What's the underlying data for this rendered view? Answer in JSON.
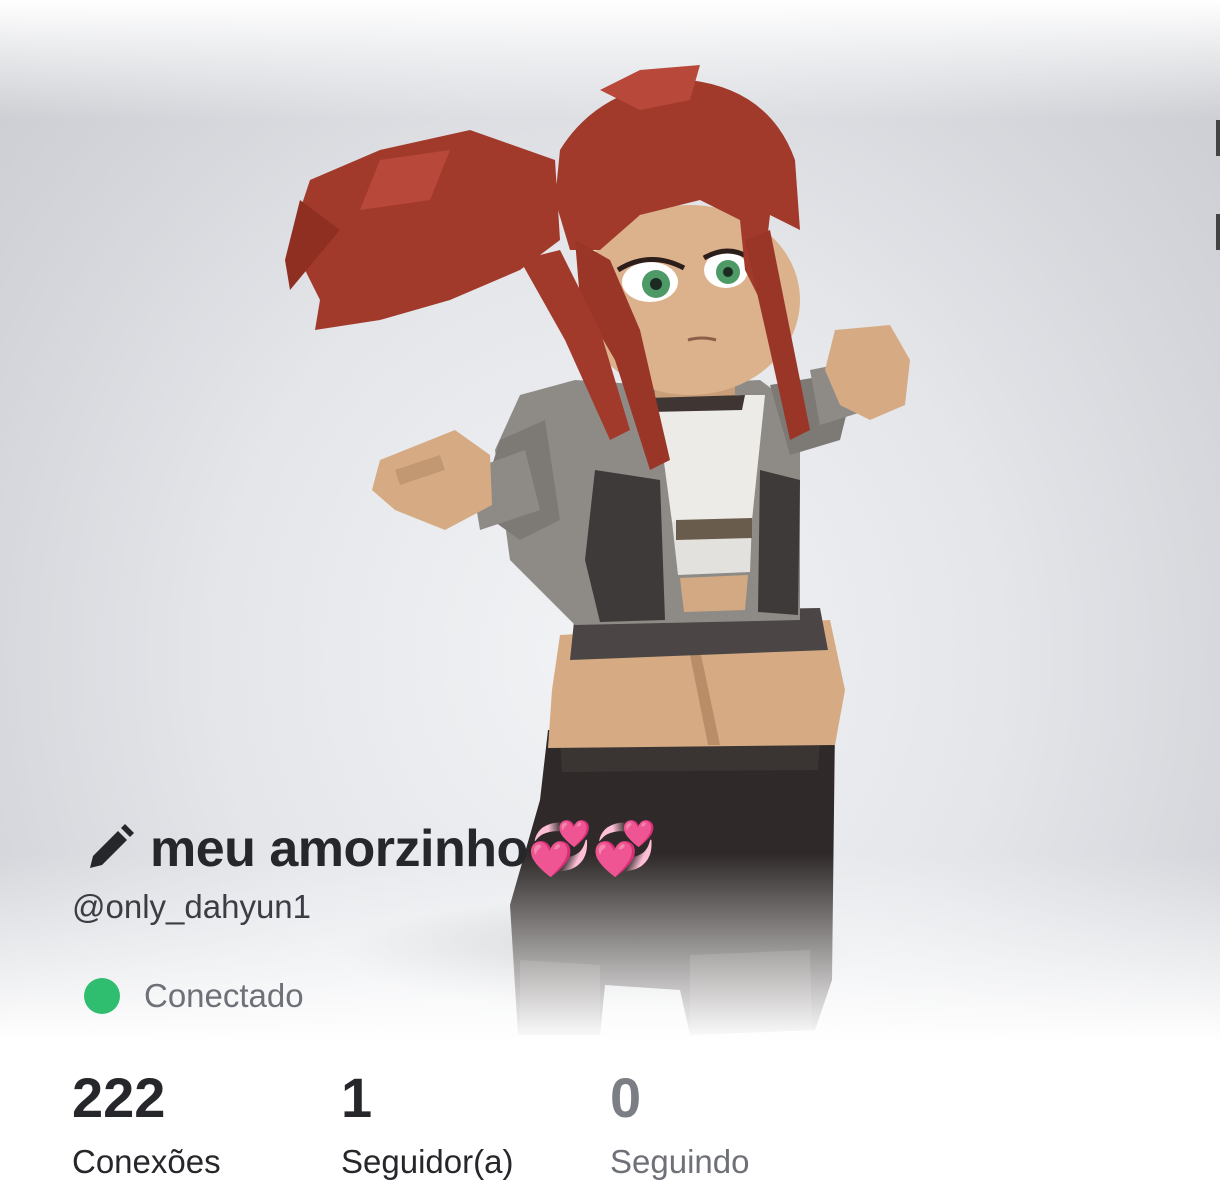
{
  "profile": {
    "display_name": "meu amorzinho💞💞",
    "username": "@only_dahyun1",
    "status": "Conectado",
    "status_color": "#2fbe6f"
  },
  "stats": [
    {
      "value": "222",
      "label": "Conexões"
    },
    {
      "value": "1",
      "label": "Seguidor(a)"
    },
    {
      "value": "0",
      "label": "Seguindo"
    }
  ],
  "icons": {
    "edit": "pencil-icon",
    "avatar": "avatar-3d-render"
  },
  "colors": {
    "hair": "#a23a2c",
    "skin": "#dcb28c",
    "jacket": "#8e8b86",
    "boots": "#2f2a29"
  }
}
